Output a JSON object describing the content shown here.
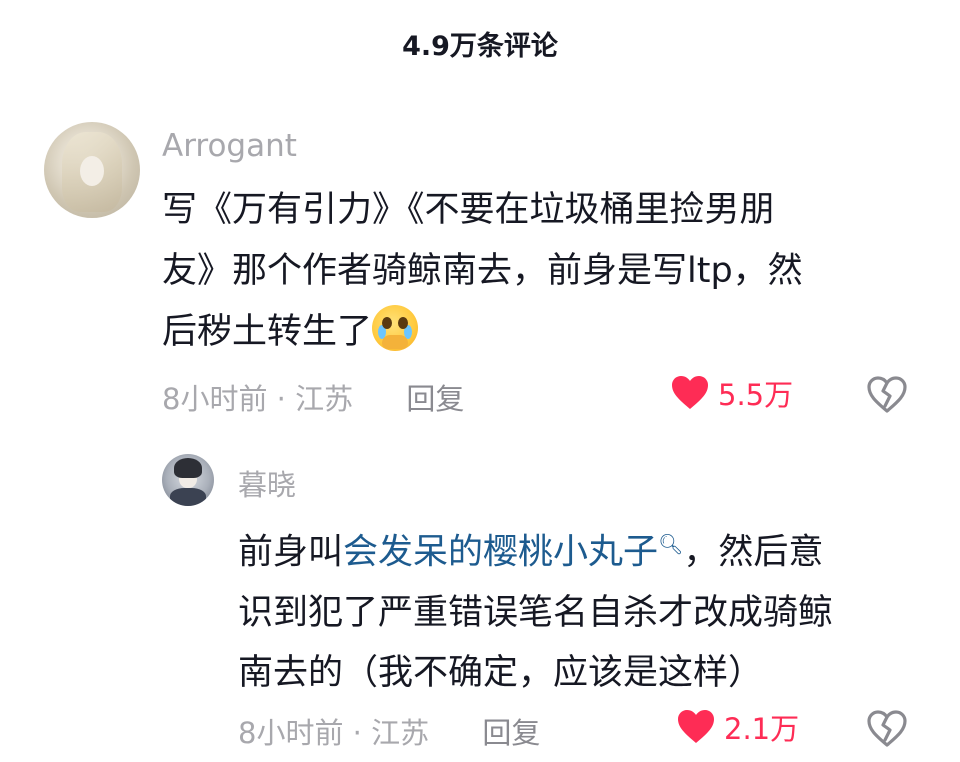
{
  "header": {
    "title": "4.9万条评论"
  },
  "comment": {
    "username": "Arrogant",
    "text_lines": [
      "写《万有引力》《不要在垃圾桶里捡男朋",
      "友》那个作者骑鲸南去，前身是写ltp，然",
      "后秽土转生了"
    ],
    "emoji_icon": "crying-face-emoji",
    "time": "8小时前",
    "separator": "·",
    "location": "江苏",
    "reply_label": "回复",
    "like_count": "5.5万",
    "like_color": "#fe2c55"
  },
  "reply": {
    "username": "暮晓",
    "text_prefix": "前身叫",
    "link_text": "会发呆的樱桃小丸子",
    "link_icon": "search-icon",
    "text_after_link": "，然后意",
    "text_lines": [
      "识到犯了严重错误笔名自杀才改成骑鲸",
      "南去的（我不确定，应该是这样）"
    ],
    "time": "8小时前",
    "separator": "·",
    "location": "江苏",
    "reply_label": "回复",
    "like_count": "2.1万",
    "link_color": "#1d5b8f"
  }
}
